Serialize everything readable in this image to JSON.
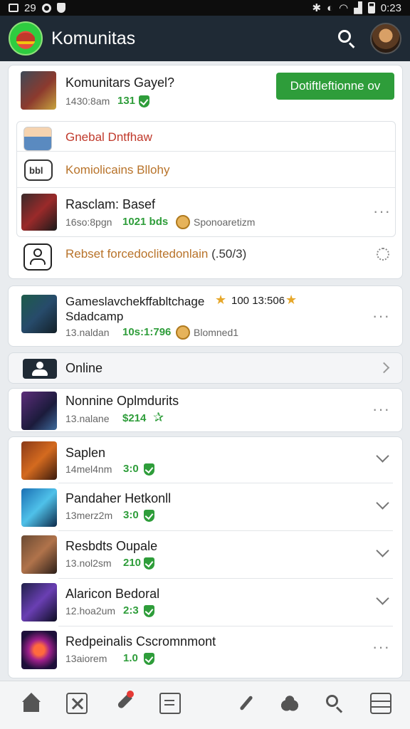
{
  "status_bar": {
    "time_left": "29",
    "time_right": "0:23"
  },
  "app_bar": {
    "title": "Komunitas"
  },
  "top_card": {
    "title": "Komunitars Gayel?",
    "meta": "1430:8am",
    "count": "131",
    "follow_button": "Dotiftleftionne ov",
    "rows": [
      {
        "label": "Gnebal Dntfhaw",
        "color": "#c0392b"
      },
      {
        "label": "Komiolicains Bllohy",
        "color": "#b8732a"
      }
    ],
    "game_row": {
      "title": "Rasclam: Basef",
      "meta": "16so:8pgn",
      "count": "1021 bds",
      "sponsor": "Sponoaretizm"
    },
    "bottom_row": {
      "label": "Rebset forcedoclitedonlain",
      "count": "(.50/3)"
    }
  },
  "event_card": {
    "line1": "Gameslavchekffabltchage",
    "star_text": "100 13:506",
    "line2": "Sdadcamp",
    "meta": "13.naldan",
    "count": "10s:1:796",
    "extra": "Blomned1"
  },
  "online_row": {
    "label": "Online"
  },
  "nonnine_card": {
    "title": "Nonnine Oplmdurits",
    "meta": "13.nalane",
    "count": "$214"
  },
  "list_items": [
    {
      "title": "Saplen",
      "meta": "14mel4nm",
      "count": "3:0"
    },
    {
      "title": "Pandaher Hetkonll",
      "meta": "13merz2m",
      "count": "3:0"
    },
    {
      "title": "Resbdts Oupale",
      "meta": "13.nol2sm",
      "count": "210"
    },
    {
      "title": "Alaricon Bedoral",
      "meta": "12.hoa2um",
      "count": "2:3"
    },
    {
      "title": "Redpeinalis Cscromnmont",
      "meta": "13aiorem",
      "count": "1.0"
    }
  ],
  "icons": {
    "status": [
      "gallery-icon",
      "settings-circle-icon",
      "shield-icon",
      "bluetooth-icon",
      "nfc-icon",
      "wifi-icon",
      "signal-icon",
      "battery-icon"
    ],
    "bottom_nav": [
      "home-icon",
      "games-icon",
      "rocket-icon",
      "news-icon",
      "pen-icon",
      "community-icon",
      "search-icon",
      "menu-icon"
    ]
  }
}
